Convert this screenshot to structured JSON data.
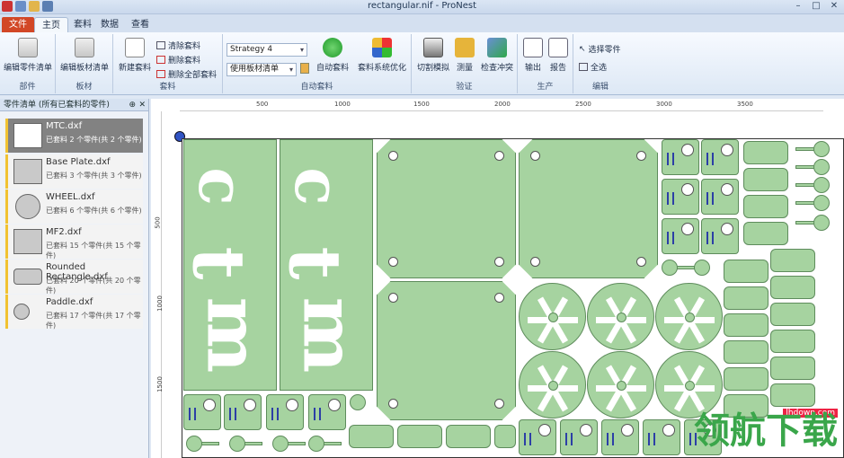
{
  "window": {
    "title": "rectangular.nif - ProNest"
  },
  "tabs": [
    "文件",
    "主页",
    "套料",
    "数据",
    "查看"
  ],
  "ribbon": {
    "parts_group": {
      "label": "部件",
      "edit_parts_list": "编辑零件清单"
    },
    "sheet_group": {
      "label": "板材",
      "edit_sheet_list": "编辑板材清单"
    },
    "nest_group": {
      "label": "套料",
      "new_nest": "新建套料",
      "clear_nest": "清除套料",
      "delete_nest": "删除套料",
      "delete_all_nests": "删除全部套料"
    },
    "auto_group": {
      "label": "自动套料",
      "strategy": "Strategy 4",
      "sheet_list": "使用板材清单",
      "auto_nest": "自动套料",
      "optimize": "套料系统优化"
    },
    "verify_group": {
      "label": "验证",
      "simulate": "切割模拟",
      "measure": "测量",
      "check_collision": "检查冲突"
    },
    "output_group": {
      "label": "生产",
      "output": "输出",
      "report": "报告"
    },
    "edit_group": {
      "label": "编辑",
      "select_part": "选择零件",
      "select_all": "全选"
    }
  },
  "sidebar": {
    "title": "零件清单 (所有已套料的零件)",
    "parts": [
      {
        "name": "MTC.dxf",
        "count": "已套料 2 个零件(共 2 个零件)"
      },
      {
        "name": "Base Plate.dxf",
        "count": "已套料 3 个零件(共 3 个零件)"
      },
      {
        "name": "WHEEL.dxf",
        "count": "已套料 6 个零件(共 6 个零件)"
      },
      {
        "name": "MF2.dxf",
        "count": "已套料 15 个零件(共 15 个零件)"
      },
      {
        "name": "Rounded Rectangle.dxf",
        "count": "已套料 20 个零件(共 20 个零件)"
      },
      {
        "name": "Paddle.dxf",
        "count": "已套料 17 个零件(共 17 个零件)"
      }
    ]
  },
  "ruler": {
    "h_ticks": [
      "500",
      "1000",
      "1500",
      "2000",
      "2500",
      "3000",
      "3500"
    ],
    "v_ticks": [
      "500",
      "1000",
      "1500"
    ]
  },
  "watermark": {
    "text": "领航下载",
    "url": "lhdown.com"
  },
  "colors": {
    "part_fill": "#a6d3a0",
    "accent": "#f1c232",
    "file_tab": "#d24726"
  }
}
